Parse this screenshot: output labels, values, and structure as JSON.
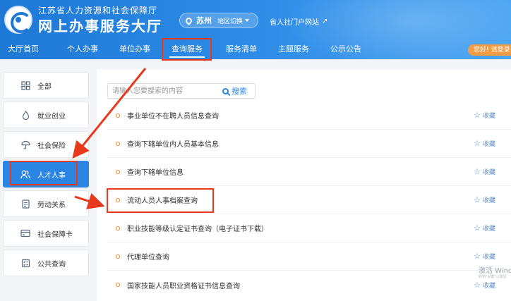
{
  "header": {
    "org_name": "江苏省人力资源和社会保障厅",
    "site_title": "网上办事服务大厅",
    "city": "苏州",
    "city_switch": "地区切换",
    "portal_link": "省人社门户网站",
    "login_prompt": "您好! 请登录"
  },
  "nav": {
    "items": [
      "大厅首页",
      "个人办事",
      "单位办事",
      "查询服务",
      "服务清单",
      "主题服务",
      "公示公告"
    ],
    "active_index": 3
  },
  "sidebar": {
    "items": [
      {
        "label": "全部",
        "icon": "grid-icon"
      },
      {
        "label": "就业创业",
        "icon": "flame-icon"
      },
      {
        "label": "社会保险",
        "icon": "umbrella-icon"
      },
      {
        "label": "人才人事",
        "icon": "people-icon"
      },
      {
        "label": "劳动关系",
        "icon": "document-icon"
      },
      {
        "label": "社会保障卡",
        "icon": "card-icon"
      },
      {
        "label": "公共查询",
        "icon": "checklist-icon"
      }
    ],
    "active_index": 3
  },
  "search": {
    "placeholder": "请输入您要搜索的内容",
    "button_label": "搜索"
  },
  "list": {
    "fav_label": "收藏",
    "items": [
      "事业单位不在聘人员信息查询",
      "查询下辖单位内人员基本信息",
      "查询下辖单位信息",
      "流动人员人事档案查询",
      "职业技能等级认定证书查询（电子证书下载）",
      "代理单位查询",
      "国家技能人员职业资格证书信息查询"
    ],
    "highlight_index": 3
  },
  "watermark": {
    "line1": "激活 Windo",
    "line2": "转到\"设置\"以激活"
  },
  "colors": {
    "header_blue": "#1e78d6",
    "active_blue": "#2b86e3",
    "annotation_red": "#e8391c",
    "bullet_orange": "#f08a2c",
    "login_orange": "#f39c42"
  }
}
